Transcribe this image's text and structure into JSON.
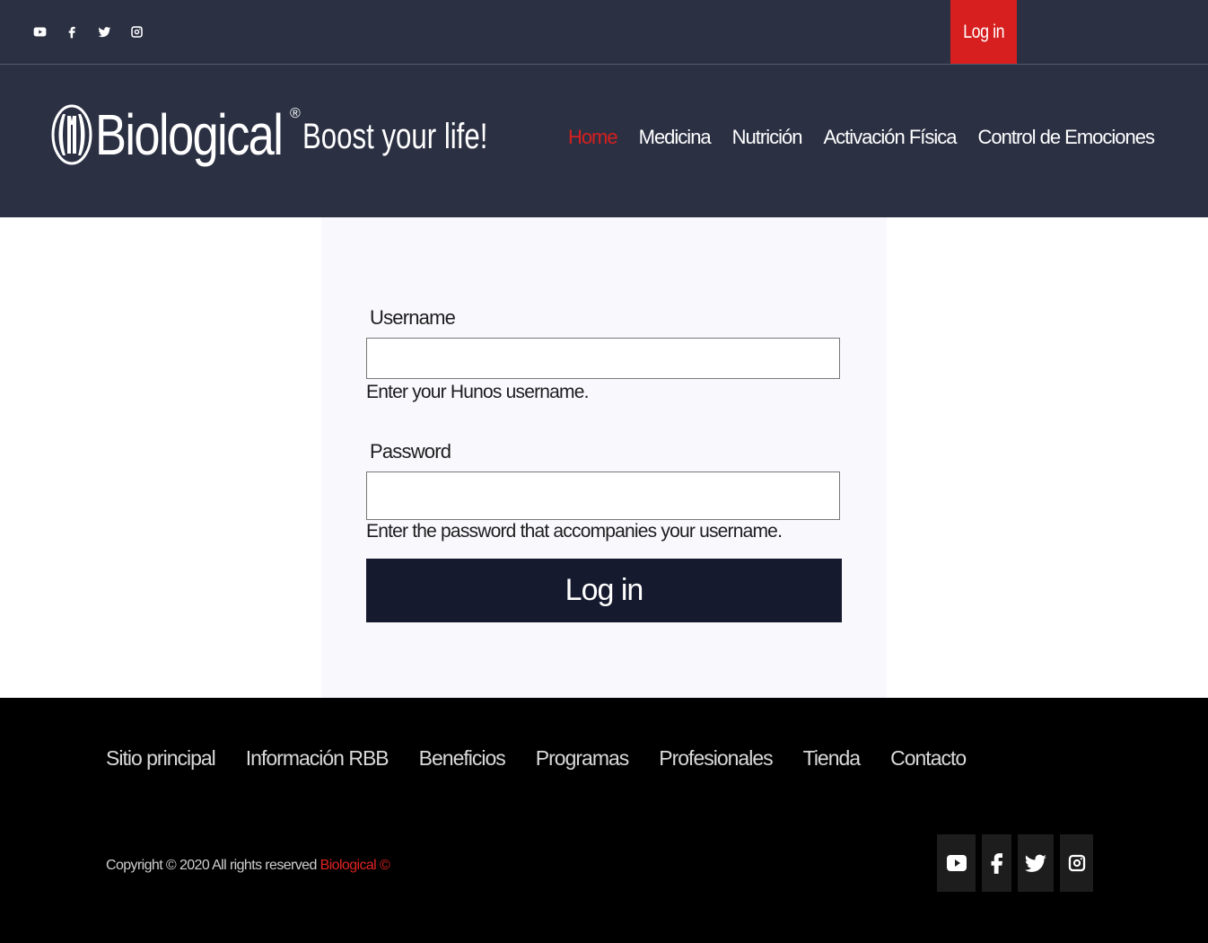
{
  "topbar": {
    "social_icons": [
      "youtube-icon",
      "facebook-icon",
      "twitter-icon",
      "instagram-icon"
    ],
    "login_label": "Log in",
    "login_color": "#d71f1f"
  },
  "header": {
    "brand": "Biological",
    "registered_mark": "®",
    "tagline": "Boost your life!",
    "nav": [
      {
        "label": "Home",
        "active": true
      },
      {
        "label": "Medicina",
        "active": false
      },
      {
        "label": "Nutrición",
        "active": false
      },
      {
        "label": "Activación Física",
        "active": false
      },
      {
        "label": "Control de Emociones",
        "active": false
      }
    ],
    "background": "#2b3043",
    "accent": "#d71f1f"
  },
  "login_form": {
    "username_label": "Username",
    "username_value": "",
    "username_hint": "Enter your Hunos username.",
    "password_label": "Password",
    "password_value": "",
    "password_hint": "Enter the password that accompanies your username.",
    "submit_label": "Log in",
    "submit_color": "#151a2e"
  },
  "footer": {
    "links": [
      "Sitio principal",
      "Información RBB",
      "Beneficios",
      "Programas",
      "Profesionales",
      "Tienda",
      "Contacto"
    ],
    "copyright_text": "Copyright © 2020 All rights reserved",
    "copyright_brand": "Biological ©",
    "social_icons": [
      "youtube-icon",
      "facebook-icon",
      "twitter-icon",
      "instagram-icon"
    ]
  }
}
